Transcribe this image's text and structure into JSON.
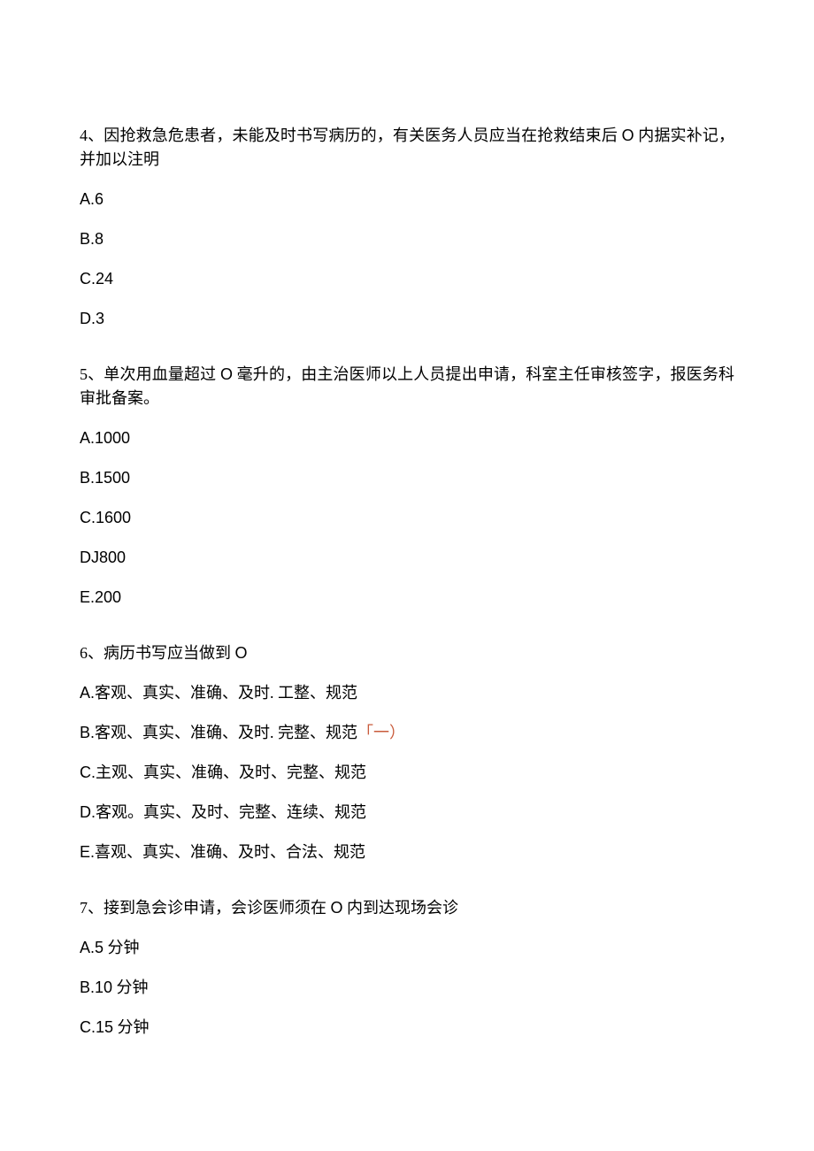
{
  "q4": {
    "stem_a": "4、因抢救急危患者，未能及时书写病历的，有关医务人员应当在抢救结束后",
    "stem_placeholder": "O",
    "stem_b": "内据实补记，并加以注明",
    "options": {
      "a": "A.6",
      "b": "B.8",
      "c": "C.24",
      "d": "D.3"
    }
  },
  "q5": {
    "stem_a": "5、单次用血量超过",
    "stem_placeholder": "O",
    "stem_b": "毫升的，由主治医师以上人员提出申请，科室主任审核签字，报医务科审批备案。",
    "options": {
      "a": "A.1000",
      "b": "B.1500",
      "c": "C.1600",
      "d": "DJ800",
      "e": "E.200"
    }
  },
  "q6": {
    "stem_a": "6、病历书写应当做到",
    "stem_placeholder": "O",
    "options": {
      "a_prefix": "A.",
      "a_text": "客观、真实、准确、及时. 工整、规范",
      "b_prefix": "B.",
      "b_text": "客观、真实、准确、及时. 完整、规范",
      "b_annot": "「一）",
      "c_prefix": "C.",
      "c_text": "主观、真实、准确、及时、完整、规范",
      "d_prefix": "D.",
      "d_text": "客观。真实、及时、完整、连续、规范",
      "e_prefix": "E.",
      "e_text": "喜观、真实、准确、及时、合法、规范"
    }
  },
  "q7": {
    "stem_a": "7、接到急会诊申请，会诊医师须在",
    "stem_placeholder": "O",
    "stem_b": "内到达现场会诊",
    "options": {
      "a_prefix": "A.5",
      "a_suffix": "分钟",
      "b_prefix": "B.10",
      "b_suffix": "分钟",
      "c_prefix": "C.15",
      "c_suffix": "分钟"
    }
  }
}
